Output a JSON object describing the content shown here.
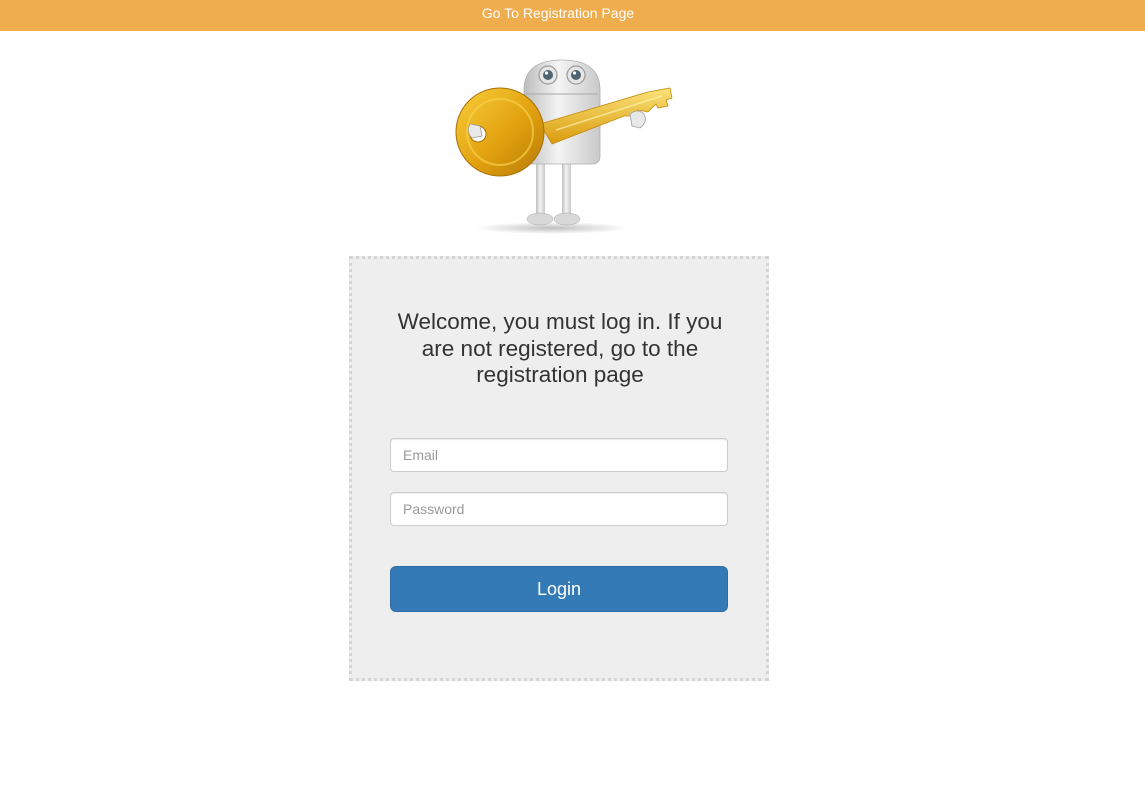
{
  "topbar": {
    "link_label": "Go To Registration Page",
    "background": "#f0ad4e"
  },
  "mascot": {
    "icon": "robot-holding-key-icon"
  },
  "login_panel": {
    "heading": "Welcome, you must log in. If you are not registered, go to the registration page",
    "email_placeholder": "Email",
    "password_placeholder": "Password",
    "login_label": "Login",
    "button_color": "#337ab7",
    "panel_color": "#eeeeee"
  }
}
